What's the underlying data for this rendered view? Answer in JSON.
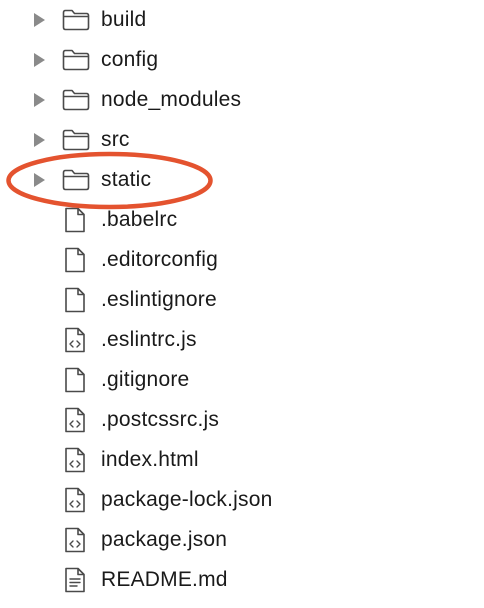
{
  "file_tree": {
    "items": [
      {
        "label": "build",
        "type": "folder",
        "expanded": false,
        "icon": "folder-icon"
      },
      {
        "label": "config",
        "type": "folder",
        "expanded": false,
        "icon": "folder-icon"
      },
      {
        "label": "node_modules",
        "type": "folder",
        "expanded": false,
        "icon": "folder-icon"
      },
      {
        "label": "src",
        "type": "folder",
        "expanded": false,
        "icon": "folder-icon"
      },
      {
        "label": "static",
        "type": "folder",
        "expanded": false,
        "icon": "folder-icon",
        "highlighted": true
      },
      {
        "label": ".babelrc",
        "type": "file",
        "icon": "file-icon"
      },
      {
        "label": ".editorconfig",
        "type": "file",
        "icon": "file-icon"
      },
      {
        "label": ".eslintignore",
        "type": "file",
        "icon": "file-icon"
      },
      {
        "label": ".eslintrc.js",
        "type": "file",
        "icon": "code-file-icon"
      },
      {
        "label": ".gitignore",
        "type": "file",
        "icon": "file-icon"
      },
      {
        "label": ".postcssrc.js",
        "type": "file",
        "icon": "code-file-icon"
      },
      {
        "label": "index.html",
        "type": "file",
        "icon": "code-file-icon"
      },
      {
        "label": "package-lock.json",
        "type": "file",
        "icon": "code-file-icon"
      },
      {
        "label": "package.json",
        "type": "file",
        "icon": "code-file-icon"
      },
      {
        "label": "README.md",
        "type": "file",
        "icon": "text-file-icon"
      }
    ]
  },
  "colors": {
    "chevron": "#8a8a8a",
    "icon_stroke": "#4a4a4a",
    "text": "#1a1a1a",
    "highlight_ring": "#e4532f"
  }
}
